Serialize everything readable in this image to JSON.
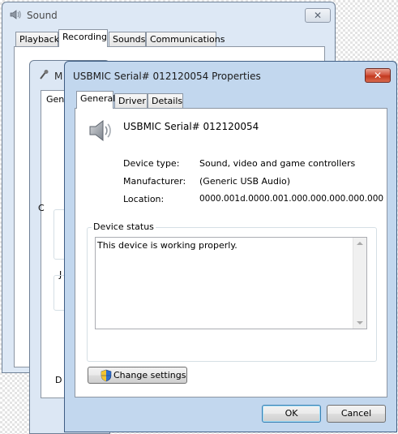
{
  "back_window": {
    "title": "Sound",
    "tabs": [
      {
        "label": "Playback",
        "selected": false
      },
      {
        "label": "Recording",
        "selected": true
      },
      {
        "label": "Sounds",
        "selected": false
      },
      {
        "label": "Communications",
        "selected": false
      }
    ],
    "close_label": "✕"
  },
  "middle_window": {
    "title_fragment": "M",
    "tab_fragment": "Gen",
    "side_fragments": [
      "C",
      "J",
      "D"
    ]
  },
  "front_window": {
    "title": "USBMIC Serial# 012120054  Properties",
    "close_label": "✕",
    "tabs": [
      {
        "label": "General",
        "selected": true
      },
      {
        "label": "Driver",
        "selected": false
      },
      {
        "label": "Details",
        "selected": false
      }
    ],
    "device_name": "USBMIC Serial# 012120054",
    "device_icon": "speaker-icon",
    "properties": {
      "type_label": "Device type:",
      "type_value": "Sound, video and game controllers",
      "manufacturer_label": "Manufacturer:",
      "manufacturer_value": "(Generic USB Audio)",
      "location_label": "Location:",
      "location_value": "0000.001d.0000.001.000.000.000.000.000"
    },
    "status_group_label": "Device status",
    "status_text": "This device is working properly.",
    "change_settings_label": "Change settings",
    "ok_label": "OK",
    "cancel_label": "Cancel"
  }
}
